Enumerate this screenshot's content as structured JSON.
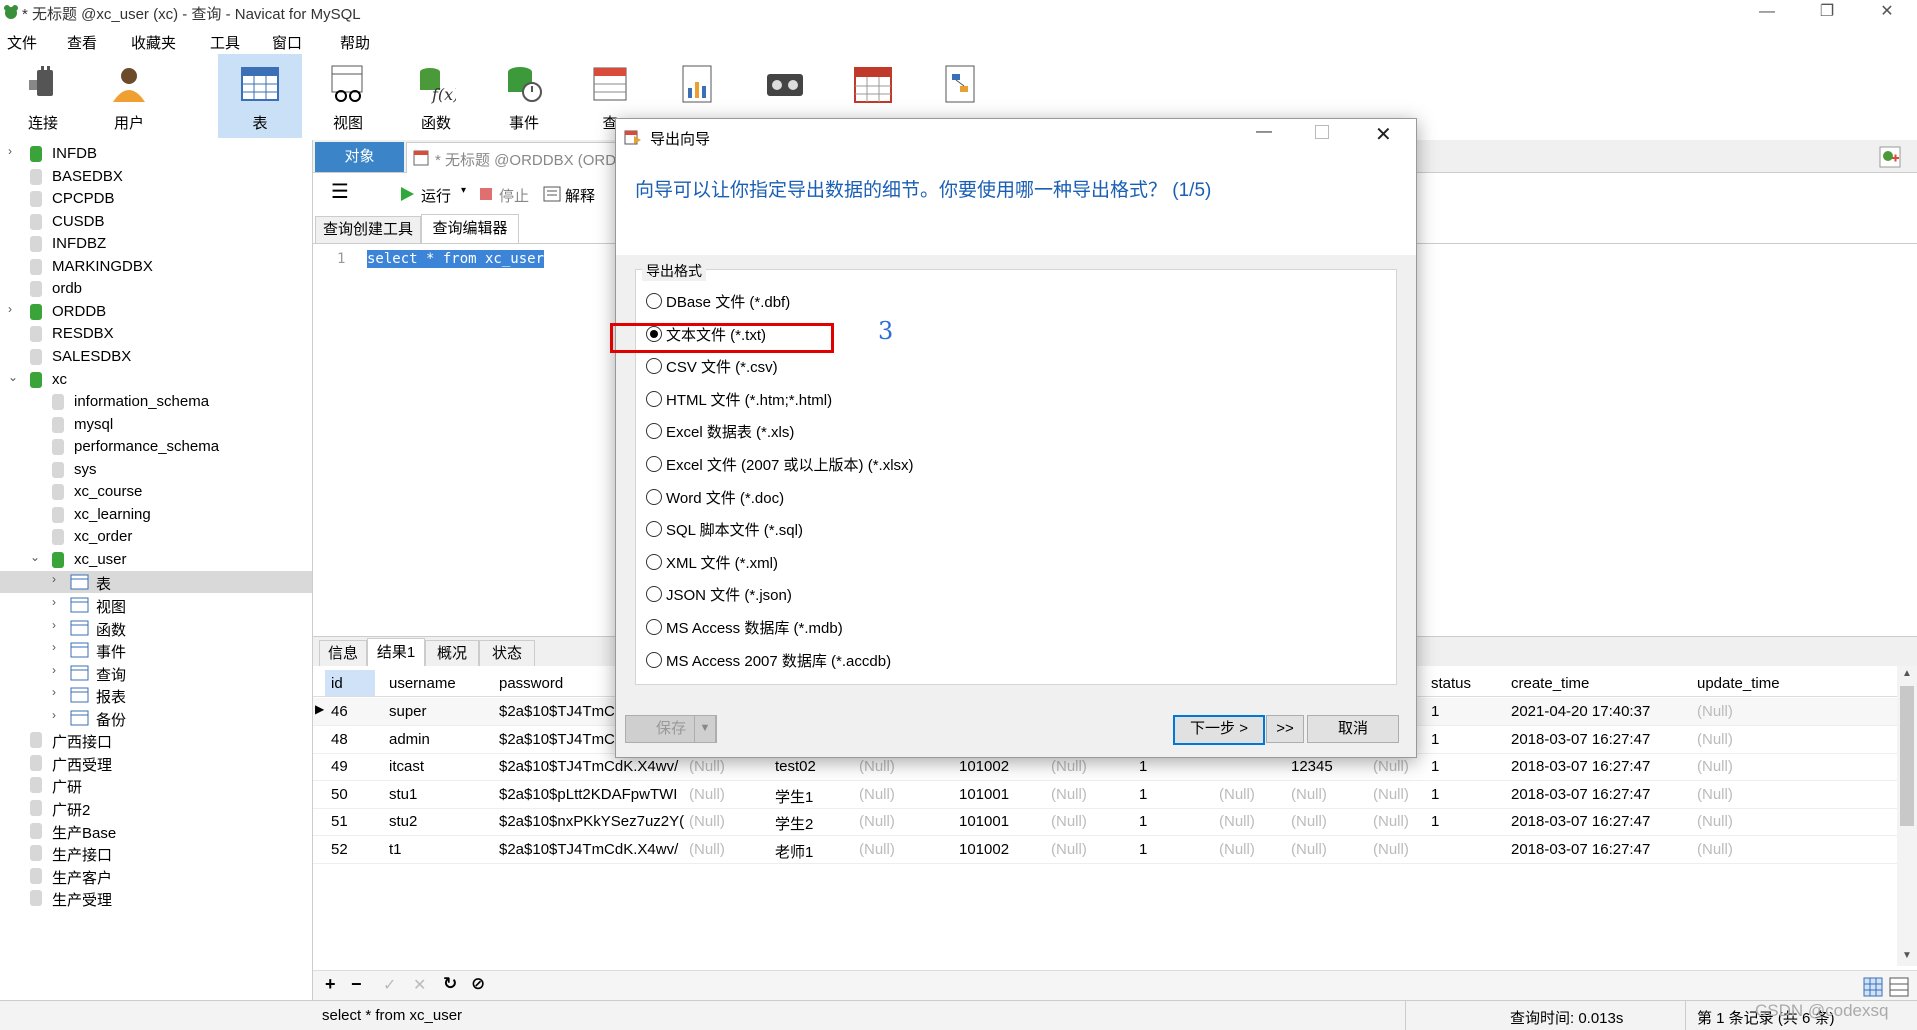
{
  "window": {
    "title": "* 无标题 @xc_user (xc) - 查询 - Navicat for MySQL"
  },
  "menu": [
    "文件",
    "查看",
    "收藏夹",
    "工具",
    "窗口",
    "帮助"
  ],
  "toolbar": [
    {
      "label": "连接",
      "icon": "plug-icon"
    },
    {
      "label": "用户",
      "icon": "user-icon"
    },
    {
      "label": "表",
      "icon": "table-icon"
    },
    {
      "label": "视图",
      "icon": "view-icon"
    },
    {
      "label": "函数",
      "icon": "function-icon"
    },
    {
      "label": "事件",
      "icon": "event-icon"
    },
    {
      "label": "查",
      "icon": "query-icon"
    },
    {
      "label": "",
      "icon": "report-icon"
    },
    {
      "label": "",
      "icon": "backup-icon"
    },
    {
      "label": "",
      "icon": "schedule-icon"
    },
    {
      "label": "",
      "icon": "model-icon"
    }
  ],
  "sidebar": {
    "items": [
      {
        "label": "INFDB",
        "level": 0,
        "expanded": false,
        "active": true
      },
      {
        "label": "BASEDBX",
        "level": 0
      },
      {
        "label": "CPCPDB",
        "level": 0
      },
      {
        "label": "CUSDB",
        "level": 0
      },
      {
        "label": "INFDBZ",
        "level": 0
      },
      {
        "label": "MARKINGDBX",
        "level": 0
      },
      {
        "label": "ordb",
        "level": 0
      },
      {
        "label": "ORDDB",
        "level": 0,
        "expanded": false,
        "active": true
      },
      {
        "label": "RESDBX",
        "level": 0
      },
      {
        "label": "SALESDBX",
        "level": 0
      },
      {
        "label": "xc",
        "level": 0,
        "expanded": true,
        "active": true
      },
      {
        "label": "information_schema",
        "level": 1
      },
      {
        "label": "mysql",
        "level": 1
      },
      {
        "label": "performance_schema",
        "level": 1
      },
      {
        "label": "sys",
        "level": 1
      },
      {
        "label": "xc_course",
        "level": 1
      },
      {
        "label": "xc_learning",
        "level": 1
      },
      {
        "label": "xc_order",
        "level": 1
      },
      {
        "label": "xc_user",
        "level": 1,
        "expanded": true,
        "active": true
      },
      {
        "label": "表",
        "level": 2,
        "selected": true
      },
      {
        "label": "视图",
        "level": 2
      },
      {
        "label": "函数",
        "level": 2
      },
      {
        "label": "事件",
        "level": 2
      },
      {
        "label": "查询",
        "level": 2
      },
      {
        "label": "报表",
        "level": 2
      },
      {
        "label": "备份",
        "level": 2
      },
      {
        "label": "广西接口",
        "level": 0
      },
      {
        "label": "广西受理",
        "level": 0
      },
      {
        "label": "广研",
        "level": 0
      },
      {
        "label": "广研2",
        "level": 0
      },
      {
        "label": "生产Base",
        "level": 0
      },
      {
        "label": "生产接口",
        "level": 0
      },
      {
        "label": "生产客户",
        "level": 0
      },
      {
        "label": "生产受理",
        "level": 0
      }
    ]
  },
  "tabs": {
    "objects": "对象",
    "query": "* 无标题 @ORDDBX (ORD"
  },
  "query_toolbar": {
    "run": "运行",
    "stop": "停止",
    "explain": "解释"
  },
  "editor_tabs": [
    "查询创建工具",
    "查询编辑器"
  ],
  "editor": {
    "line": "1",
    "sql": "select * from xc_user"
  },
  "result_tabs": [
    "信息",
    "结果1",
    "概况",
    "状态"
  ],
  "grid": {
    "columns": [
      "id",
      "username",
      "password",
      "status",
      "create_time",
      "update_time"
    ],
    "rows": [
      {
        "id": "46",
        "username": "super",
        "password": "$2a$10$TJ4TmC",
        "mid": [],
        "status": "1",
        "create_time": "2021-04-20 17:40:37",
        "update_time": "(Null)"
      },
      {
        "id": "48",
        "username": "admin",
        "password": "$2a$10$TJ4TmC",
        "mid": [],
        "status": "1",
        "create_time": "2018-03-07 16:27:47",
        "update_time": "(Null)"
      },
      {
        "id": "49",
        "username": "itcast",
        "password": "$2a$10$TJ4TmCdK.X4wv/",
        "mid": [
          "(Null)",
          "test02",
          "(Null)",
          "101002",
          "(Null)",
          "1",
          "",
          "12345",
          "(Null)"
        ],
        "status": "1",
        "create_time": "2018-03-07 16:27:47",
        "update_time": "(Null)"
      },
      {
        "id": "50",
        "username": "stu1",
        "password": "$2a$10$pLtt2KDAFpwTWI",
        "mid": [
          "(Null)",
          "学生1",
          "(Null)",
          "101001",
          "(Null)",
          "1",
          "(Null)",
          "(Null)",
          "(Null)"
        ],
        "status": "1",
        "create_time": "2018-03-07 16:27:47",
        "update_time": "(Null)"
      },
      {
        "id": "51",
        "username": "stu2",
        "password": "$2a$10$nxPKkYSez7uz2Y(",
        "mid": [
          "(Null)",
          "学生2",
          "(Null)",
          "101001",
          "(Null)",
          "1",
          "(Null)",
          "(Null)",
          "(Null)"
        ],
        "status": "1",
        "create_time": "2018-03-07 16:27:47",
        "update_time": "(Null)"
      },
      {
        "id": "52",
        "username": "t1",
        "password": "$2a$10$TJ4TmCdK.X4wv/",
        "mid": [
          "(Null)",
          "老师1",
          "(Null)",
          "101002",
          "(Null)",
          "1",
          "(Null)",
          "(Null)",
          "(Null)"
        ],
        "status": "",
        "create_time": "2018-03-07 16:27:47",
        "update_time": "(Null)"
      }
    ]
  },
  "grid_toolbar": [
    "+",
    "−",
    "✓",
    "✕",
    "↻",
    "⊘"
  ],
  "status": {
    "sql": "select * from xc_user",
    "query_time": "查询时间: 0.013s",
    "records": "第 1 条记录 (共 6 条)",
    "watermark": "CSDN @codexsq"
  },
  "dialog": {
    "title": "导出向导",
    "heading": "向导可以让你指定导出数据的细节。你要使用哪一种导出格式？ (1/5)",
    "group_label": "导出格式",
    "formats": [
      "DBase 文件 (*.dbf)",
      "文本文件 (*.txt)",
      "CSV 文件 (*.csv)",
      "HTML 文件 (*.htm;*.html)",
      "Excel 数据表 (*.xls)",
      "Excel 文件 (2007 或以上版本) (*.xlsx)",
      "Word 文件 (*.doc)",
      "SQL 脚本文件 (*.sql)",
      "XML 文件 (*.xml)",
      "JSON 文件 (*.json)",
      "MS Access 数据库 (*.mdb)",
      "MS Access 2007 数据库 (*.accdb)"
    ],
    "selected_index": 1,
    "annotation": "3",
    "buttons": {
      "save": "保存",
      "next": "下一步 >",
      "last": ">>",
      "cancel": "取消"
    }
  }
}
